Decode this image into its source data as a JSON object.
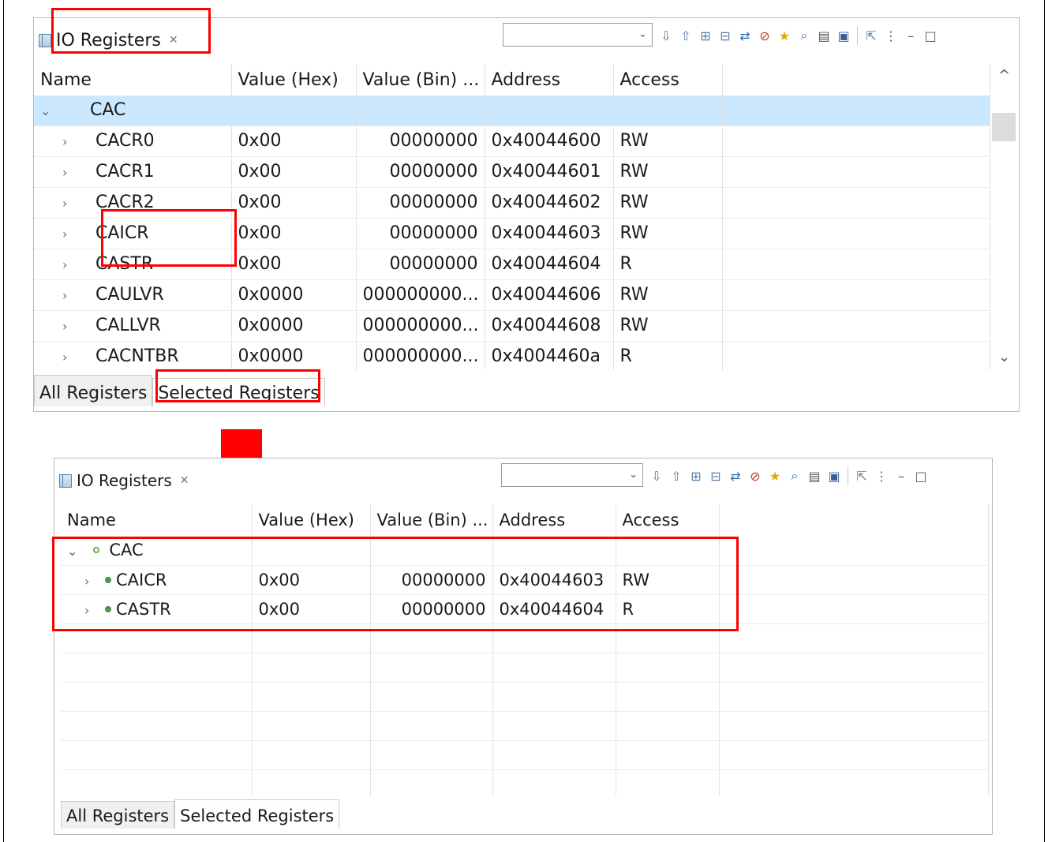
{
  "colors": {
    "accent": "#ff0000",
    "selection": "#cce8ff",
    "dot": "#4c9a52"
  },
  "top": {
    "view_title": "IO Registers",
    "close_glyph": "✕",
    "columns": [
      "Name",
      "Value (Hex)",
      "Value (Bin) ...",
      "Address",
      "Access"
    ],
    "group": {
      "expander": "⌄",
      "name": "CAC"
    },
    "rows": [
      {
        "expander": "›",
        "name": "CACR0",
        "hex": "0x00",
        "bin": "00000000",
        "address": "0x40044600",
        "access": "RW"
      },
      {
        "expander": "›",
        "name": "CACR1",
        "hex": "0x00",
        "bin": "00000000",
        "address": "0x40044601",
        "access": "RW"
      },
      {
        "expander": "›",
        "name": "CACR2",
        "hex": "0x00",
        "bin": "00000000",
        "address": "0x40044602",
        "access": "RW"
      },
      {
        "expander": "›",
        "name": "CAICR",
        "hex": "0x00",
        "bin": "00000000",
        "address": "0x40044603",
        "access": "RW"
      },
      {
        "expander": "›",
        "name": "CASTR",
        "hex": "0x00",
        "bin": "00000000",
        "address": "0x40044604",
        "access": "R"
      },
      {
        "expander": "›",
        "name": "CAULVR",
        "hex": "0x0000",
        "bin": "000000000...",
        "address": "0x40044606",
        "access": "RW"
      },
      {
        "expander": "›",
        "name": "CALLVR",
        "hex": "0x0000",
        "bin": "000000000...",
        "address": "0x40044608",
        "access": "RW"
      },
      {
        "expander": "›",
        "name": "CACNTBR",
        "hex": "0x0000",
        "bin": "000000000...",
        "address": "0x4004460a",
        "access": "R"
      }
    ],
    "tabs": [
      "All Registers",
      "Selected Registers"
    ],
    "scroll_up": "^",
    "scroll_down": "⌄"
  },
  "bottom": {
    "view_title": "IO Registers",
    "close_glyph": "✕",
    "columns": [
      "Name",
      "Value (Hex)",
      "Value (Bin) ...",
      "Address",
      "Access"
    ],
    "group": {
      "expander": "⌄",
      "name": "CAC"
    },
    "rows": [
      {
        "expander": "›",
        "name": "CAICR",
        "hex": "0x00",
        "bin": "00000000",
        "address": "0x40044603",
        "access": "RW"
      },
      {
        "expander": "›",
        "name": "CASTR",
        "hex": "0x00",
        "bin": "00000000",
        "address": "0x40044604",
        "access": "R"
      }
    ],
    "tabs": [
      "All Registers",
      "Selected Registers"
    ]
  },
  "toolbar_icons": [
    "arrow-down-icon",
    "arrow-up-icon",
    "expand-all-icon",
    "collapse-all-icon",
    "refresh-icon",
    "clear-icon",
    "star-icon",
    "search-icon",
    "print-icon",
    "save-icon",
    "export-icon",
    "view-menu-icon",
    "minimize-icon",
    "maximize-icon"
  ],
  "toolbar_glyphs": [
    "⇩",
    "⇧",
    "⊞",
    "⊟",
    "⇄",
    "⊘",
    "★",
    "⌕",
    "▤",
    "▣",
    "⇱",
    "⋮",
    "–",
    "□"
  ]
}
